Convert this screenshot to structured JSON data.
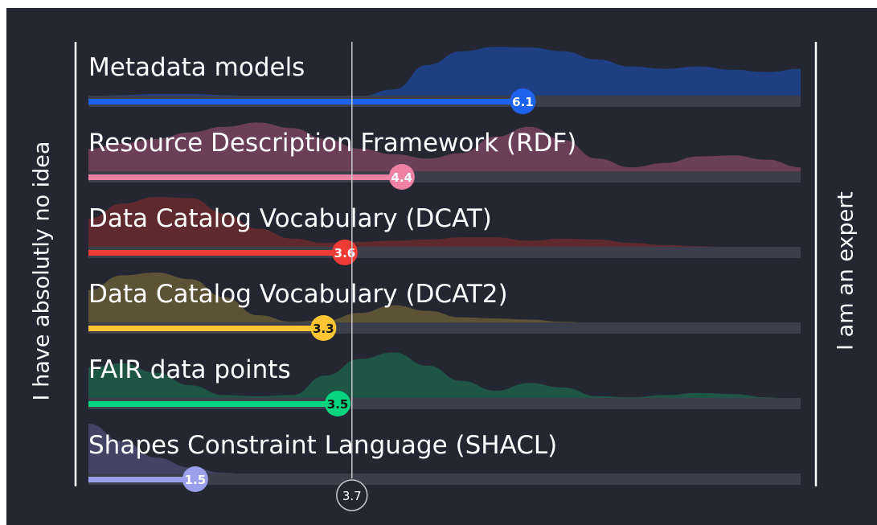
{
  "chart_data": {
    "type": "bar",
    "left_label": "I have absolutly no idea",
    "right_label": "I am an expert",
    "scale": [
      0,
      10
    ],
    "mean": 3.7,
    "mean_label": "3.7",
    "items": [
      {
        "name": "Metadata models",
        "value": 6.1,
        "value_label": "6.1",
        "color": "#1f62ee",
        "fill": "#1e3f82",
        "text_color": "#ffffff",
        "distribution": [
          0.08,
          0.1,
          0.12,
          0.12,
          0.1,
          0.08,
          0.06,
          0.06,
          0.08,
          0.2,
          0.65,
          0.9,
          0.98,
          0.97,
          0.9,
          0.75,
          0.62,
          0.58,
          0.62,
          0.56,
          0.52,
          0.58
        ]
      },
      {
        "name": "Resource Description Framework (RDF)",
        "value": 4.4,
        "value_label": "4.4",
        "color": "#ef82a4",
        "fill": "#6a3f57",
        "text_color": "#ffffff",
        "distribution": [
          0.5,
          0.6,
          0.68,
          0.8,
          0.9,
          0.98,
          0.88,
          0.68,
          0.5,
          0.4,
          0.32,
          0.42,
          0.72,
          0.9,
          0.66,
          0.32,
          0.16,
          0.24,
          0.36,
          0.38,
          0.3,
          0.16
        ]
      },
      {
        "name": "Data Catalog Vocabulary (DCAT)",
        "value": 3.6,
        "value_label": "3.6",
        "color": "#ef3b36",
        "fill": "#5f2a2e",
        "text_color": "#ffffff",
        "distribution": [
          0.6,
          0.88,
          1.0,
          0.98,
          0.7,
          0.42,
          0.24,
          0.16,
          0.18,
          0.2,
          0.22,
          0.26,
          0.26,
          0.2,
          0.24,
          0.22,
          0.16,
          0.12,
          0.1,
          0.08,
          0.04,
          0.02
        ]
      },
      {
        "name": "Data Catalog Vocabulary (DCAT2)",
        "value": 3.3,
        "value_label": "3.3",
        "color": "#ffc533",
        "fill": "#5c5236",
        "text_color": "#111111",
        "distribution": [
          0.68,
          0.95,
          1.0,
          0.88,
          0.55,
          0.22,
          0.1,
          0.12,
          0.26,
          0.4,
          0.3,
          0.18,
          0.16,
          0.14,
          0.1,
          0.08,
          0.08,
          0.07,
          0.06,
          0.06,
          0.05,
          0.04
        ]
      },
      {
        "name": "FAIR data points",
        "value": 3.5,
        "value_label": "3.5",
        "color": "#07d47f",
        "fill": "#1f5544",
        "text_color": "#111111",
        "distribution": [
          0.65,
          0.72,
          0.55,
          0.32,
          0.14,
          0.12,
          0.14,
          0.5,
          0.8,
          0.92,
          0.68,
          0.4,
          0.22,
          0.36,
          0.28,
          0.12,
          0.1,
          0.14,
          0.18,
          0.16,
          0.1,
          0.04
        ]
      },
      {
        "name": "Shapes Constraint Language (SHACL)",
        "value": 1.5,
        "value_label": "1.5",
        "color": "#9aa0eb",
        "fill": "#434364",
        "text_color": "#ffffff",
        "distribution": [
          1.0,
          0.68,
          0.38,
          0.2,
          0.1,
          0.05,
          0.03,
          0.02,
          0.015,
          0.01,
          0.01,
          0.0,
          0.0,
          0.0,
          0.0,
          0.0,
          0.0,
          0.0,
          0.0,
          0.0,
          0.0,
          0.0
        ]
      }
    ]
  }
}
